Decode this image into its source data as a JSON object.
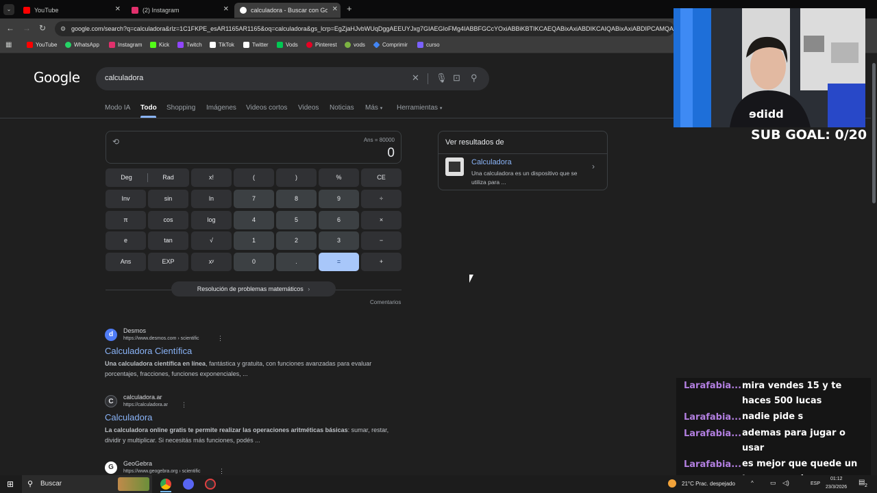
{
  "browser": {
    "tabs": [
      {
        "title": "YouTube",
        "color": "#ff0000",
        "active": false
      },
      {
        "title": "(2) Instagram",
        "color": "#e1306c",
        "active": false
      },
      {
        "title": "calculadora - Buscar con Googl",
        "color": "#4285f4",
        "active": true
      }
    ],
    "new_tab": "+",
    "tab_menu_icon": "chevron-down-icon",
    "url": "google.com/search?q=calculadora&rlz=1C1FKPE_esAR1165AR1165&oq=calculadora&gs_lcrp=EgZjaHJvbWUqDggAEEUYJxg7GIAEGIoFMg4IABBFGCcYOxiABBiKBTIKCAEQABixAxiABDIKCAIQABixAxiABDIPCAMQABg",
    "bookmarks": [
      {
        "label": "YouTube",
        "color": "#ff0000"
      },
      {
        "label": "WhatsApp",
        "color": "#25d366"
      },
      {
        "label": "Instagram",
        "color": "#e1306c"
      },
      {
        "label": "Kick",
        "color": "#53fc18"
      },
      {
        "label": "Twitch",
        "color": "#9146ff"
      },
      {
        "label": "TikTok",
        "color": "#ffffff"
      },
      {
        "label": "Twitter",
        "color": "#ffffff"
      },
      {
        "label": "Vods",
        "color": "#00c853"
      },
      {
        "label": "Pinterest",
        "color": "#e60023"
      },
      {
        "label": "vods",
        "color": "#7cb342"
      },
      {
        "label": "Comprimir",
        "color": "#4285f4"
      },
      {
        "label": "curso",
        "color": "#7b61ff"
      }
    ]
  },
  "google": {
    "logo": "Google",
    "query": "calculadora",
    "nav": [
      "Modo IA",
      "Todo",
      "Shopping",
      "Imágenes",
      "Videos cortos",
      "Videos",
      "Noticias",
      "Más",
      "Herramientas"
    ],
    "active_nav": "Todo"
  },
  "calculator": {
    "ans": "Ans = 80000",
    "display": "0",
    "keys": {
      "deg": "Deg",
      "rad": "Rad",
      "fact": "x!",
      "lparen": "(",
      "rparen": ")",
      "percent": "%",
      "ce": "CE",
      "inv": "Inv",
      "sin": "sin",
      "ln": "ln",
      "k7": "7",
      "k8": "8",
      "k9": "9",
      "div": "÷",
      "pi": "π",
      "cos": "cos",
      "log": "log",
      "k4": "4",
      "k5": "5",
      "k6": "6",
      "mul": "×",
      "e": "e",
      "tan": "tan",
      "sqrt": "√",
      "k1": "1",
      "k2": "2",
      "k3": "3",
      "minus": "−",
      "ansk": "Ans",
      "exp": "EXP",
      "pow": "xʸ",
      "k0": "0",
      "dot": ".",
      "eq": "=",
      "plus": "+"
    },
    "solve_link": "Resolución de problemas matemáticos",
    "feedback": "Comentarios"
  },
  "results": [
    {
      "site": "Desmos",
      "url": "https://www.desmos.com › scientific",
      "favicon": "d",
      "title": "Calculadora Científica",
      "snippet_bold": "Una calculadora científica en línea",
      "snippet": ", fantástica y gratuita, con funciones avanzadas para evaluar porcentajes, fracciones, funciones exponenciales, ..."
    },
    {
      "site": "calculadora.ar",
      "url": "https://calculadora.ar",
      "favicon": "C",
      "title": "Calculadora",
      "snippet_bold": "La calculadora online gratis te permite realizar las operaciones aritméticas básicas",
      "snippet": ": sumar, restar, dividir y multiplicar. Si necesitás más funciones, podés ..."
    },
    {
      "site": "GeoGebra",
      "url": "https://www.geogebra.org › scientific",
      "favicon": "G"
    }
  ],
  "side_panel": {
    "heading": "Ver resultados de",
    "item_title": "Calculadora",
    "item_desc": "Una calculadora es un dispositivo que se utiliza para ..."
  },
  "stream": {
    "sub_goal": "SUB GOAL: 0/20",
    "chat": [
      {
        "user": "Larafabia...",
        "message": "mira vendes 15 y te haces 500 lucas"
      },
      {
        "user": "Larafabia...",
        "message": "nadie pide s"
      },
      {
        "user": "Larafabia...",
        "message": "ademas para jugar o usar"
      },
      {
        "user": "Larafabia...",
        "message": "es mejor que quede un toque grande"
      }
    ]
  },
  "taskbar": {
    "search_placeholder": "Buscar",
    "weather": "21°C  Prac. despejado",
    "lang": "ESP",
    "time": "01:12",
    "date": "23/3/2026",
    "notif_count": "2"
  }
}
